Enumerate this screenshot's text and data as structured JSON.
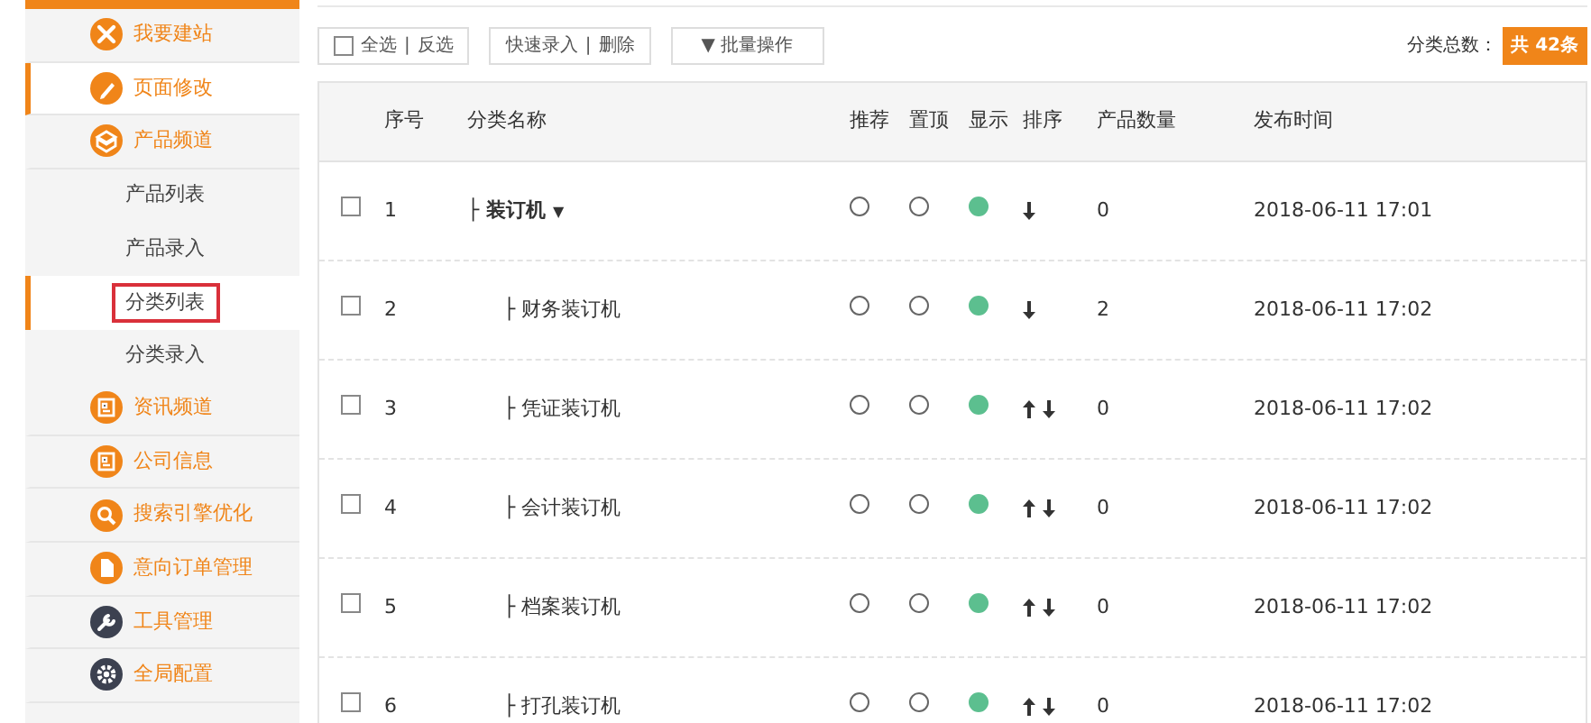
{
  "sidebar": {
    "items": [
      {
        "label": "我要建站",
        "kind": "tools",
        "color": "#f08519",
        "selected": false
      },
      {
        "label": "页面修改",
        "kind": "pencil",
        "color": "#f08519",
        "selected": true
      },
      {
        "label": "产品频道",
        "kind": "box",
        "color": "#f08519",
        "selected": false,
        "children": [
          {
            "label": "产品列表",
            "selected": false,
            "highlighted": false
          },
          {
            "label": "产品录入",
            "selected": false,
            "highlighted": false
          },
          {
            "label": "分类列表",
            "selected": true,
            "highlighted": true
          },
          {
            "label": "分类录入",
            "selected": false,
            "highlighted": false
          }
        ]
      },
      {
        "label": "资讯频道",
        "kind": "doc",
        "color": "#f08519",
        "selected": false
      },
      {
        "label": "公司信息",
        "kind": "doc",
        "color": "#f08519",
        "selected": false
      },
      {
        "label": "搜索引擎优化",
        "kind": "search",
        "color": "#f08519",
        "selected": false
      },
      {
        "label": "意向订单管理",
        "kind": "file",
        "color": "#f08519",
        "selected": false
      },
      {
        "label": "工具管理",
        "kind": "wrench",
        "color": "#3c4150",
        "selected": false
      },
      {
        "label": "全局配置",
        "kind": "gear",
        "color": "#3c4150",
        "selected": false
      }
    ]
  },
  "toolbar": {
    "select_all_checked": false,
    "select_all": "全选",
    "separator_1": "|",
    "invert": "反选",
    "quick_add": "快速录入",
    "separator_2": "|",
    "delete": "删除",
    "batch_caret": "▼",
    "batch": "批量操作",
    "total_label": "分类总数：",
    "total_badge": "共 42条"
  },
  "table": {
    "columns": [
      "序号",
      "分类名称",
      "推荐",
      "置顶",
      "显示",
      "排序",
      "产品数量",
      "发布时间"
    ],
    "rows": [
      {
        "seq": "1",
        "prefix": "├",
        "name": "装订机",
        "caret": "▼",
        "expanded": true,
        "checked": false,
        "recommend": false,
        "pinned": false,
        "shown": true,
        "move_up": false,
        "move_down": true,
        "count": "0",
        "time": "2018-06-11 17:01",
        "children": [
          {
            "seq": "2",
            "prefix": "├",
            "name": "财务装订机",
            "checked": false,
            "recommend": false,
            "pinned": false,
            "shown": true,
            "move_up": false,
            "move_down": true,
            "count": "2",
            "time": "2018-06-11 17:02"
          },
          {
            "seq": "3",
            "prefix": "├",
            "name": "凭证装订机",
            "checked": false,
            "recommend": false,
            "pinned": false,
            "shown": true,
            "move_up": true,
            "move_down": true,
            "count": "0",
            "time": "2018-06-11 17:02"
          },
          {
            "seq": "4",
            "prefix": "├",
            "name": "会计装订机",
            "checked": false,
            "recommend": false,
            "pinned": false,
            "shown": true,
            "move_up": true,
            "move_down": true,
            "count": "0",
            "time": "2018-06-11 17:02"
          },
          {
            "seq": "5",
            "prefix": "├",
            "name": "档案装订机",
            "checked": false,
            "recommend": false,
            "pinned": false,
            "shown": true,
            "move_up": true,
            "move_down": true,
            "count": "0",
            "time": "2018-06-11 17:02"
          },
          {
            "seq": "6",
            "prefix": "├",
            "name": "打孔装订机",
            "checked": false,
            "recommend": false,
            "pinned": false,
            "shown": true,
            "move_up": true,
            "move_down": true,
            "count": "0",
            "time": "2018-06-11 17:02"
          }
        ]
      }
    ]
  }
}
